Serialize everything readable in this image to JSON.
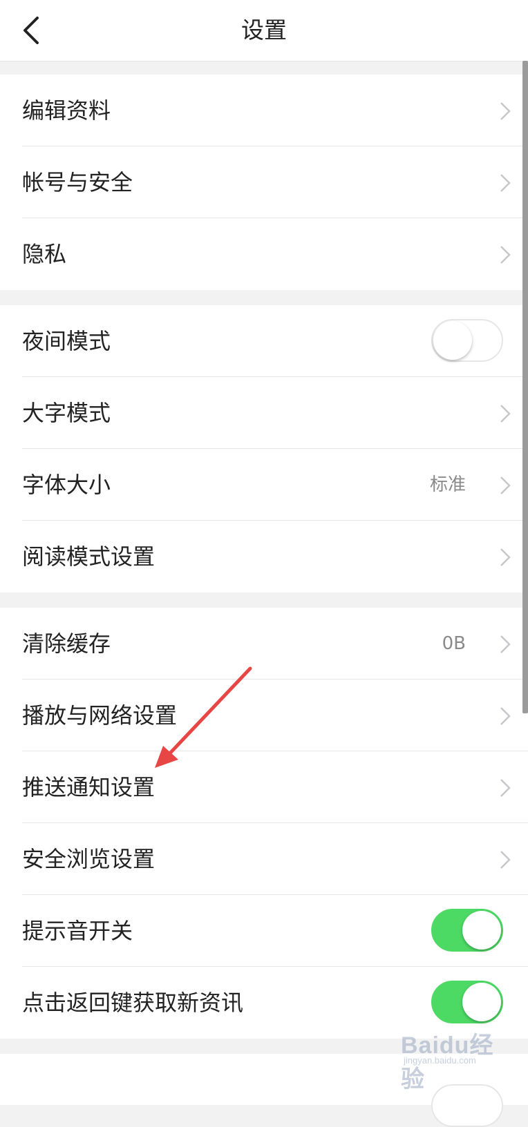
{
  "header": {
    "title": "设置"
  },
  "sections": [
    {
      "items": [
        {
          "label": "编辑资料"
        },
        {
          "label": "帐号与安全"
        },
        {
          "label": "隐私"
        }
      ]
    },
    {
      "items": [
        {
          "label": "夜间模式",
          "toggle": "off"
        },
        {
          "label": "大字模式"
        },
        {
          "label": "字体大小",
          "value": "标准"
        },
        {
          "label": "阅读模式设置"
        }
      ]
    },
    {
      "items": [
        {
          "label": "清除缓存",
          "value": "0B"
        },
        {
          "label": "播放与网络设置"
        },
        {
          "label": "推送通知设置"
        },
        {
          "label": "安全浏览设置"
        },
        {
          "label": "提示音开关",
          "toggle": "on"
        },
        {
          "label": "点击返回键获取新资讯",
          "toggle": "on"
        }
      ]
    }
  ],
  "watermark": {
    "logo": "Baidu经验",
    "sub": "jingyan.baidu.com"
  },
  "colors": {
    "accent_green": "#4cd964",
    "annotation_arrow": "#e84545"
  }
}
